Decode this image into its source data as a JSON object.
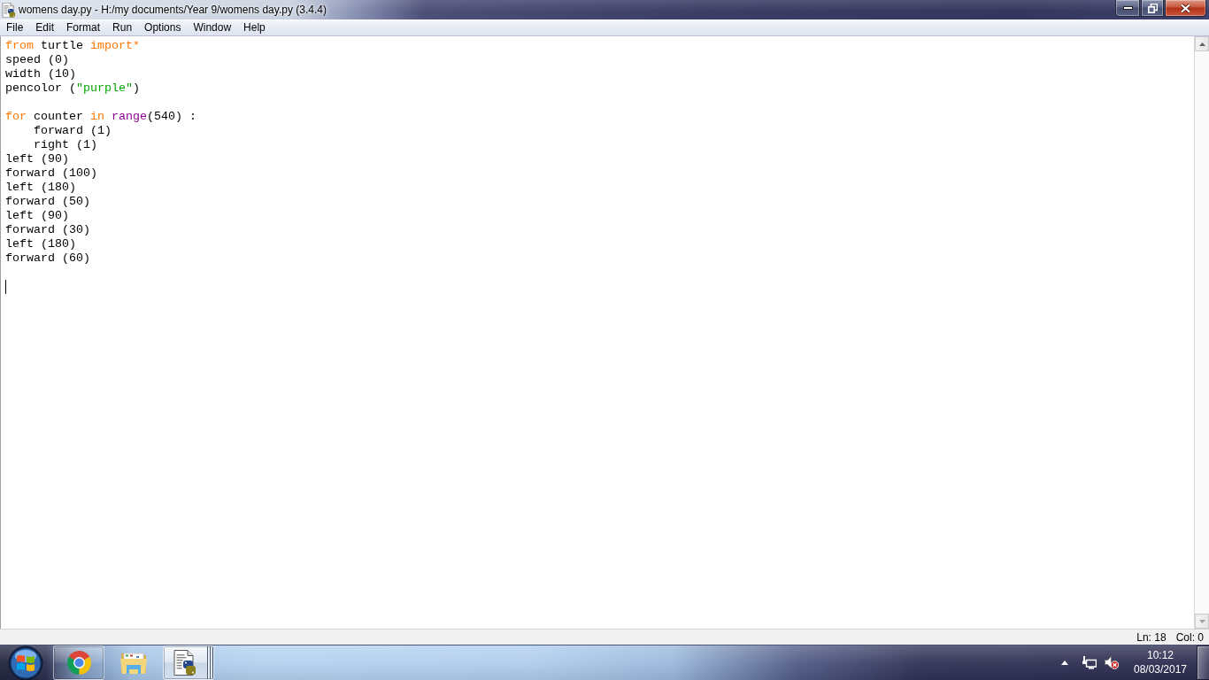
{
  "window": {
    "title": "womens day.py - H:/my documents/Year 9/womens day.py (3.4.4)"
  },
  "menu_bar": [
    "File",
    "Edit",
    "Format",
    "Run",
    "Options",
    "Window",
    "Help"
  ],
  "editor": {
    "blocks": [
      {
        "lines": [
          {
            "tokens": [
              {
                "kind": "keyword",
                "text": "from"
              },
              {
                "kind": "plain",
                "text": " turtle "
              },
              {
                "kind": "keyword",
                "text": "import*"
              }
            ]
          },
          {
            "tokens": [
              {
                "kind": "plain",
                "text": "speed (0)"
              }
            ]
          },
          {
            "tokens": [
              {
                "kind": "plain",
                "text": "width (10)"
              }
            ]
          },
          {
            "tokens": [
              {
                "kind": "plain",
                "text": "pencolor ("
              },
              {
                "kind": "string",
                "text": "\"purple\""
              },
              {
                "kind": "plain",
                "text": ")"
              }
            ]
          }
        ]
      },
      {
        "lines": [
          {
            "tokens": [
              {
                "kind": "keyword",
                "text": "for"
              },
              {
                "kind": "plain",
                "text": " counter "
              },
              {
                "kind": "keyword",
                "text": "in"
              },
              {
                "kind": "builtin",
                "text": " range"
              },
              {
                "kind": "plain",
                "text": "(540) :"
              }
            ],
            "children": [
              {
                "tokens": [
                  {
                    "kind": "plain",
                    "text": "forward (1)"
                  }
                ]
              },
              {
                "tokens": [
                  {
                    "kind": "plain",
                    "text": "right (1)"
                  }
                ]
              }
            ]
          },
          {
            "tokens": [
              {
                "kind": "plain",
                "text": "left (90)"
              }
            ]
          },
          {
            "tokens": [
              {
                "kind": "plain",
                "text": "forward (100)"
              }
            ]
          },
          {
            "tokens": [
              {
                "kind": "plain",
                "text": "left (180)"
              }
            ]
          },
          {
            "tokens": [
              {
                "kind": "plain",
                "text": "forward (50)"
              }
            ]
          },
          {
            "tokens": [
              {
                "kind": "plain",
                "text": "left (90)"
              }
            ]
          },
          {
            "tokens": [
              {
                "kind": "plain",
                "text": "forward (30)"
              }
            ]
          },
          {
            "tokens": [
              {
                "kind": "plain",
                "text": "left (180)"
              }
            ]
          },
          {
            "tokens": [
              {
                "kind": "plain",
                "text": "forward (60)"
              }
            ]
          }
        ]
      }
    ]
  },
  "status_bar": {
    "line": "Ln: 18",
    "column": "Col: 0"
  },
  "taskbar": {
    "apps": [
      {
        "kind": "browser",
        "running": true,
        "selected": false,
        "stacked": false
      },
      {
        "kind": "folder",
        "running": false,
        "selected": false,
        "stacked": false
      },
      {
        "kind": "python",
        "running": true,
        "selected": true,
        "stacked": true
      }
    ],
    "tray": {
      "volume_muted": true,
      "time": "10:12",
      "date": "08/03/2017"
    }
  }
}
